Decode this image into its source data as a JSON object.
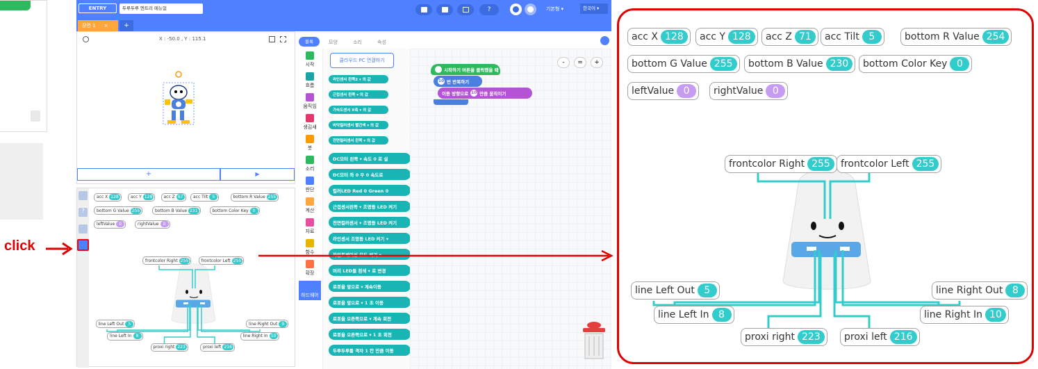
{
  "header": {
    "logo": "ENTRY",
    "project_title": "두루두루 엔트리 메뉴얼",
    "mode": "기본형",
    "language": "한국어"
  },
  "scene_tab": {
    "label": "장면 1",
    "close": "×",
    "add": "+"
  },
  "stage": {
    "coords": "X : -50.0 , Y : 115.1",
    "add": "+",
    "play": "▶"
  },
  "tabs": [
    "블록",
    "모양",
    "소리",
    "속성"
  ],
  "categories": [
    "시작",
    "흐름",
    "움직임",
    "생김새",
    "붓",
    "소리",
    "판단",
    "계산",
    "자료",
    "함수",
    "확장",
    "하드웨어"
  ],
  "palette": {
    "connect_button": "클라우드 PC 연결하기",
    "sensors": [
      "라인센서 왼쪽2 ▾ 의 값",
      "근접센서 왼쪽 ▾ 의 값",
      "가속도센서 X축 ▾ 의 값",
      "바닥컬러센서 빨간색 ▾ 의 값",
      "전면컬러센서 왼쪽 ▾ 의 값"
    ],
    "blocks": [
      "DC모터 왼쪽 ▾ 속도 0 로 설",
      "DC모터 좌 0 우 0 속도로",
      "컬러LED Red 0 Green 0",
      "근접센서왼쪽 ▾ 조명등 LED 켜기",
      "전면컬러센서 ▾ 조명등 LED 켜기",
      "라인센서 조명등 LED 켜기 ▾",
      "라인트레이싱 모드 켜기 ▾",
      "머리 LED를 흰색 ▾ 로 변경",
      "로봇을 앞으로 ▾ 계속이동",
      "로봇을 앞으로 ▾ 1 초 이동",
      "로봇을 오른쪽으로 ▾ 계속 회전",
      "로봇을 오른쪽으로 ▾ 1 초 회전",
      "두루두루를 격자 1 칸 만큼 이동"
    ]
  },
  "script": {
    "start": "시작하기 버튼을 클릭했을 때",
    "repeat": "번 반복하기",
    "repeat_n": "10",
    "move": "이동 방향으로",
    "move_n": "10",
    "move_suffix": "만큼 움직이기"
  },
  "zoom": [
    "-",
    "=",
    "+"
  ],
  "click_label": "click",
  "sensors_big": {
    "row1": [
      [
        "acc X",
        "128"
      ],
      [
        "acc Y",
        "128"
      ],
      [
        "acc Z",
        "71"
      ],
      [
        "acc Tilt",
        "5"
      ],
      [
        "bottom R Value",
        "254"
      ]
    ],
    "row2": [
      [
        "bottom G Value",
        "255"
      ],
      [
        "bottom B Value",
        "230"
      ],
      [
        "bottom Color Key",
        "0"
      ]
    ],
    "row3": [
      [
        "leftValue",
        "0"
      ],
      [
        "rightValue",
        "0"
      ]
    ],
    "frontcolor_right": [
      "frontcolor Right",
      "255"
    ],
    "frontcolor_left": [
      "frontcolor Left",
      "255"
    ],
    "line_left_out": [
      "line Left Out",
      "5"
    ],
    "line_left_in": [
      "line Left In",
      "8"
    ],
    "line_right_out": [
      "line Right Out",
      "8"
    ],
    "line_right_in": [
      "line Right In",
      "10"
    ],
    "proxi_right": [
      "proxi right",
      "223"
    ],
    "proxi_left": [
      "proxi left",
      "216"
    ]
  },
  "sensors_small": {
    "row1": [
      [
        "acc X",
        "128"
      ],
      [
        "acc Y",
        "128"
      ],
      [
        "acc Z",
        "67"
      ],
      [
        "acc Tilt",
        "5"
      ],
      [
        "bottom R Value",
        "255"
      ]
    ],
    "row2": [
      [
        "bottom G Value",
        "255"
      ],
      [
        "bottom B Value",
        "231"
      ],
      [
        "bottom Color Key",
        "0"
      ]
    ],
    "row3": [
      [
        "leftValue",
        "0"
      ],
      [
        "rightValue",
        "0"
      ]
    ],
    "frontcolor_right": [
      "frontcolor Right",
      "255"
    ],
    "frontcolor_left": [
      "frontcolor Left",
      "255"
    ],
    "line_left_out": [
      "line Left Out",
      "5"
    ],
    "line_left_in": [
      "line Left In",
      "8"
    ],
    "line_right_out": [
      "line Right Out",
      "9"
    ],
    "line_right_in": [
      "line Right In",
      "10"
    ],
    "proxi_right": [
      "proxi right",
      "223"
    ],
    "proxi_left": [
      "proxi left",
      "216"
    ]
  }
}
